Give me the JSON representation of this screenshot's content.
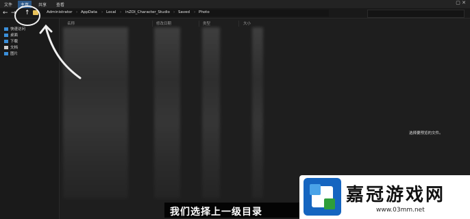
{
  "ribbon": {
    "tabs": [
      "文件",
      "主页",
      "共享",
      "查看"
    ],
    "window_controls": "▢ ✕"
  },
  "address_bar": {
    "back_glyph": "←",
    "forward_glyph": "→",
    "up_glyph": "↑",
    "breadcrumb": [
      "Administrator",
      "AppData",
      "Local",
      "inZOI_Character_Studio",
      "Saved",
      "Photo"
    ],
    "separator": "›"
  },
  "sidebar": {
    "items": [
      {
        "label": "快速访问",
        "icon": "star-icon",
        "color": "#3b8fd9"
      },
      {
        "label": "桌面",
        "icon": "desktop-icon",
        "color": "#3b8fd9"
      },
      {
        "label": "下载",
        "icon": "download-icon",
        "color": "#3b8fd9"
      },
      {
        "label": "文档",
        "icon": "document-icon",
        "color": "#cfcfcf"
      },
      {
        "label": "图片",
        "icon": "pictures-icon",
        "color": "#3b8fd9"
      }
    ]
  },
  "columns": [
    "名称",
    "修改日期",
    "类型",
    "大小"
  ],
  "preview_pane": {
    "message": "选择要预览的文件。"
  },
  "subtitle": "我们选择上一级目录",
  "watermark": {
    "title": "嘉冠游戏网",
    "url": "www.03mm.net"
  }
}
